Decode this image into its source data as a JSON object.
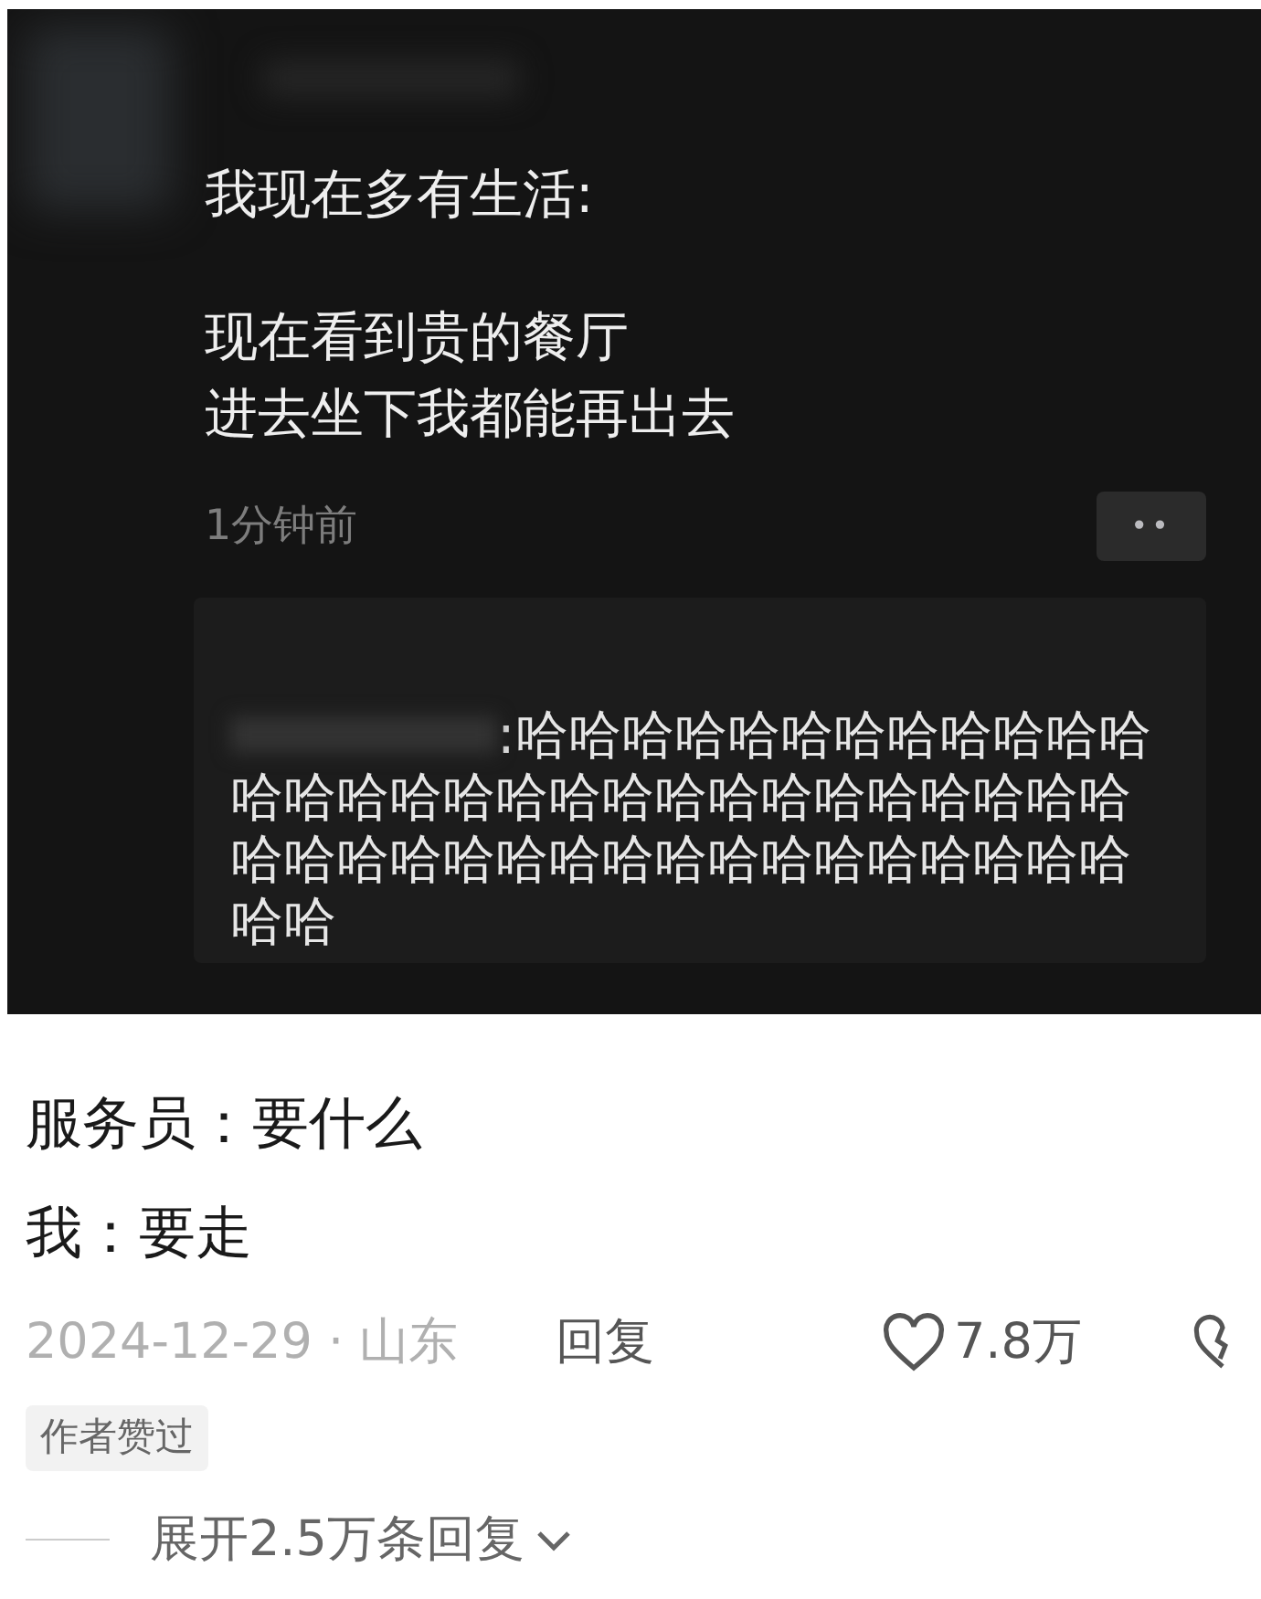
{
  "post": {
    "paragraphs": [
      [
        "我现在多有生活:"
      ],
      [
        "现在看到贵的餐厅",
        "进去坐下我都能再出去"
      ]
    ],
    "time": "1分钟前",
    "more_button": "••",
    "comment": {
      "lines": [
        ":哈哈哈哈哈哈哈哈哈哈哈哈",
        "哈哈哈哈哈哈哈哈哈哈哈哈哈哈哈哈哈",
        "哈哈哈哈哈哈哈哈哈哈哈哈哈哈哈哈哈",
        "哈哈"
      ]
    }
  },
  "reply": {
    "lines": [
      "服务员：要什么",
      "我：要走"
    ],
    "date_location": "2024-12-29 · 山东",
    "reply_link": "回复",
    "likes": "7.8万",
    "liked": false,
    "badge": "作者赞过",
    "expand": "展开2.5万条回复"
  }
}
